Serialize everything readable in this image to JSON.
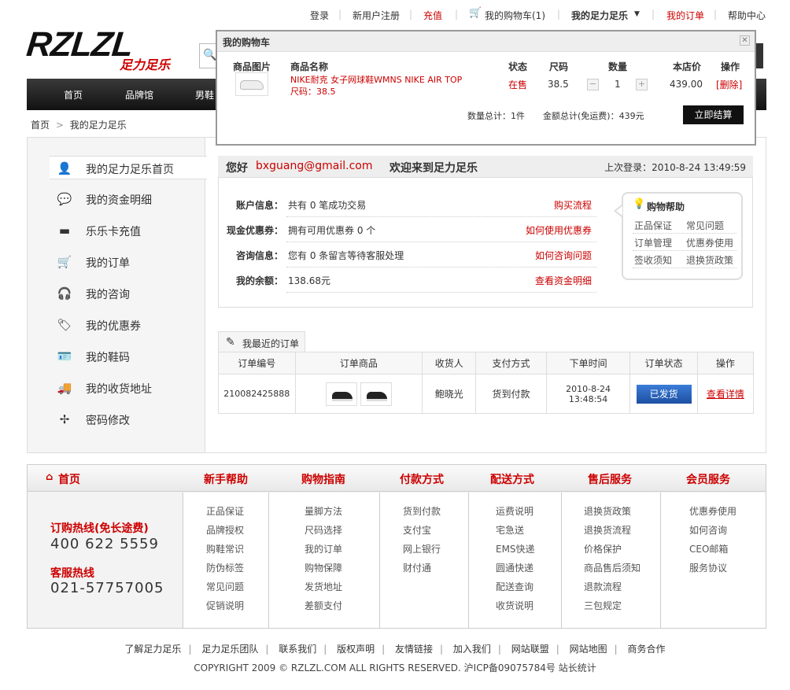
{
  "toplinks": {
    "login": "登录",
    "register": "新用户注册",
    "recharge": "充值",
    "cart": "我的购物车(1)",
    "my_account": "我的足力足乐",
    "my_orders": "我的订单",
    "help": "帮助中心"
  },
  "logo": {
    "text": "RZLZL",
    "sub": "足力足乐"
  },
  "nav": {
    "items": [
      "首页",
      "品牌馆",
      "男鞋"
    ]
  },
  "breadcrumb": {
    "home": "首页",
    "sep": ">",
    "current": "我的足力足乐"
  },
  "sidebar": {
    "items": [
      {
        "label": "我的足力足乐首页",
        "icon": "user-icon"
      },
      {
        "label": "我的资金明细",
        "icon": "chat-icon"
      },
      {
        "label": "乐乐卡充值",
        "icon": "card-icon"
      },
      {
        "label": "我的订单",
        "icon": "order-icon"
      },
      {
        "label": "我的咨询",
        "icon": "headset-icon"
      },
      {
        "label": "我的优惠券",
        "icon": "tag-icon"
      },
      {
        "label": "我的鞋码",
        "icon": "id-card-icon"
      },
      {
        "label": "我的收货地址",
        "icon": "truck-icon"
      },
      {
        "label": "密码修改",
        "icon": "key-icon"
      }
    ]
  },
  "welcome": {
    "hi": "您好",
    "email": "bxguang@gmail.com",
    "text": "欢迎来到足力足乐",
    "last_login": "上次登录：2010-8-24 13:49:59"
  },
  "account": {
    "rows": [
      {
        "key": "账户信息：",
        "value": "共有 0 笔成功交易",
        "link": "购买流程"
      },
      {
        "key": "现金优惠券：",
        "value": "拥有可用优惠券 0 个",
        "link": "如何使用优惠券"
      },
      {
        "key": "咨询信息：",
        "value": "您有 0 条留言等待客服处理",
        "link": "如何咨询问题"
      },
      {
        "key": "我的余额：",
        "value": "138.68元",
        "link": "查看资金明细"
      }
    ]
  },
  "shophelp": {
    "title": "购物帮助",
    "links": [
      "正品保证",
      "常见问题",
      "订单管理",
      "优惠券使用",
      "签收须知",
      "退换货政策"
    ]
  },
  "orders": {
    "tab": "我最近的订单",
    "headers": [
      "订单编号",
      "订单商品",
      "收货人",
      "支付方式",
      "下单时间",
      "订单状态",
      "操作"
    ],
    "row": {
      "id": "210082425888",
      "receiver": "鲍晓光",
      "payment": "货到付款",
      "date": "2010-8-24",
      "time": "13:48:54",
      "status": "已发货",
      "action": "查看详情"
    }
  },
  "footer": {
    "heads": [
      "首页",
      "新手帮助",
      "购物指南",
      "付款方式",
      "配送方式",
      "售后服务",
      "会员服务"
    ],
    "hotline_label": "订购热线(免长途费)",
    "hotline": "400 622 5559",
    "service_label": "客服热线",
    "service": "021-57757005",
    "cols": [
      [
        "正品保证",
        "品牌授权",
        "购鞋常识",
        "防伪标签",
        "常见问题",
        "促销说明"
      ],
      [
        "量脚方法",
        "尺码选择",
        "我的订单",
        "购物保障",
        "发货地址",
        "差额支付"
      ],
      [
        "货到付款",
        "支付宝",
        "网上银行",
        "财付通"
      ],
      [
        "运费说明",
        "宅急送",
        "EMS快递",
        "圆通快递",
        "配送查询",
        "收货说明"
      ],
      [
        "退换货政策",
        "退换货流程",
        "价格保护",
        "商品售后须知",
        "退款流程",
        "三包规定"
      ],
      [
        "优惠券使用",
        "如何咨询",
        "CEO邮箱",
        "服务协议"
      ]
    ],
    "links": [
      "了解足力足乐",
      "足力足乐团队",
      "联系我们",
      "版权声明",
      "友情链接",
      "加入我们",
      "网站联盟",
      "网站地图",
      "商务合作"
    ],
    "copyright": "COPYRIGHT 2009 © RZLZL.COM ALL RIGHTS RESERVED. 沪ICP备09075784号 站长统计"
  },
  "cart": {
    "title": "我的购物车",
    "headers": {
      "img": "商品图片",
      "name": "商品名称",
      "status": "状态",
      "size": "尺码",
      "qty": "数量",
      "price": "本店价",
      "op": "操作"
    },
    "item": {
      "name": "NIKE耐克 女子网球鞋WMNS NIKE AIR TOP",
      "size_line": "尺码：38.5",
      "status": "在售",
      "size": "38.5",
      "qty": "1",
      "price": "439.00",
      "delete": "[删除]"
    },
    "total_qty": "数量总计：1件",
    "total_amount": "金额总计(免运费)：439元",
    "checkout": "立即结算"
  }
}
